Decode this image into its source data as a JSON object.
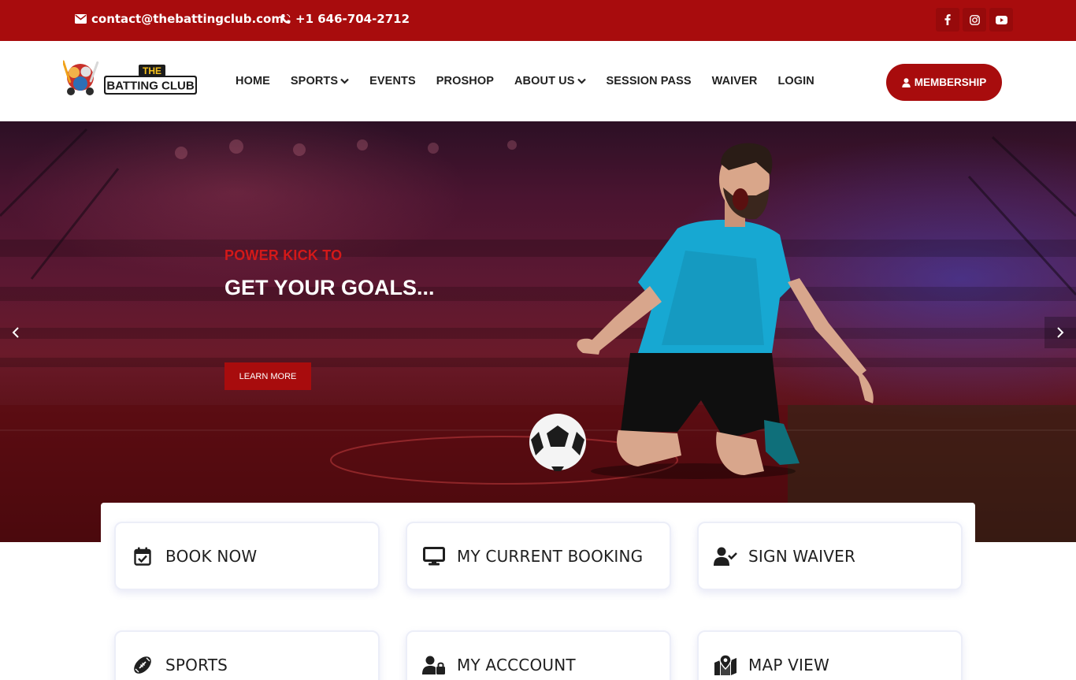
{
  "topbar": {
    "email": "contact@thebattingclub.com",
    "phone": "+1 646-704-2712",
    "social_icons": [
      "facebook-icon",
      "instagram-icon",
      "youtube-icon"
    ]
  },
  "header": {
    "logo": {
      "line1": "THE",
      "line2": "BATTING CLUB"
    },
    "nav": [
      {
        "label": "HOME",
        "has_dropdown": false
      },
      {
        "label": "SPORTS",
        "has_dropdown": true
      },
      {
        "label": "EVENTS",
        "has_dropdown": false
      },
      {
        "label": "PROSHOP",
        "has_dropdown": false
      },
      {
        "label": "ABOUT US",
        "has_dropdown": true
      },
      {
        "label": "SESSION PASS",
        "has_dropdown": false
      },
      {
        "label": "WAIVER",
        "has_dropdown": false
      },
      {
        "label": "LOGIN",
        "has_dropdown": false
      }
    ],
    "membership_label": "MEMBERSHIP"
  },
  "hero": {
    "subtitle": "POWER KICK TO",
    "title": "GET YOUR GOALS...",
    "cta_label": "LEARN MORE"
  },
  "cards": [
    {
      "label": "BOOK NOW",
      "icon": "calendar-check-icon"
    },
    {
      "label": "MY CURRENT BOOKING",
      "icon": "monitor-icon"
    },
    {
      "label": "SIGN WAIVER",
      "icon": "user-check-icon"
    },
    {
      "label": "SPORTS",
      "icon": "football-icon"
    },
    {
      "label": "MY ACCCOUNT",
      "icon": "user-lock-icon"
    },
    {
      "label": "MAP VIEW",
      "icon": "map-marker-icon"
    }
  ],
  "colors": {
    "brand_red": "#a80c0d",
    "hero_accent": "#d31919",
    "text_dark": "#1f1f1f"
  }
}
